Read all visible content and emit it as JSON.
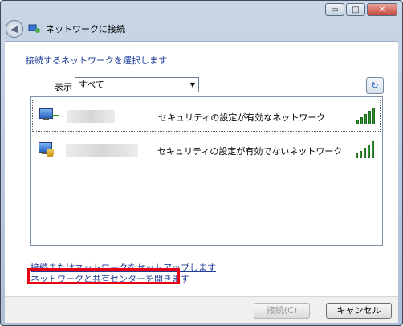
{
  "window": {
    "title": "ネットワークに接続",
    "controls": {
      "minimize": "▭",
      "maximize": "□",
      "close": "✕"
    }
  },
  "main": {
    "heading": "接続するネットワークを選択します",
    "show_label": "表示",
    "filter_selected": "すべて",
    "networks": [
      {
        "security": "セキュリティの設定が有効なネットワーク",
        "signal_bars": 5
      },
      {
        "security": "セキュリティの設定が有効でないネットワーク",
        "signal_bars": 5
      }
    ],
    "setup_link": "接続またはネットワークをセットアップします",
    "center_link": "ネットワークと共有センターを開きます"
  },
  "footer": {
    "connect_label": "接続(C)",
    "cancel_label": "キャンセル"
  },
  "colors": {
    "highlight": "#e60012",
    "link": "#1f3f9a",
    "signal": "#2f8f2f"
  },
  "icons": {
    "back": "back-arrow-icon",
    "refresh": "refresh-icon",
    "network": "network-monitor-icon",
    "signal": "signal-strength-icon"
  }
}
